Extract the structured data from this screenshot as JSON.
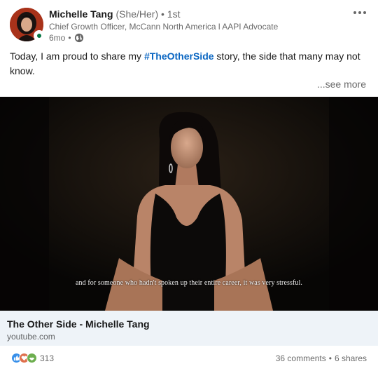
{
  "author": {
    "name": "Michelle Tang",
    "pronouns": "(She/Her)",
    "degree": "• 1st",
    "headline": "Chief Growth Officer, McCann North America l AAPI Advocate",
    "time": "6mo",
    "time_sep": "•",
    "presence_color": "#057642"
  },
  "post": {
    "text_before": "Today, I am proud to share my ",
    "hashtag": "#TheOtherSide",
    "text_after": " story, the side that many may not know.",
    "see_more": "...see more"
  },
  "video": {
    "caption": "and for someone who hadn't spoken up their entire career, it was very stressful."
  },
  "link": {
    "title": "The Other Side - Michelle Tang",
    "domain": "youtube.com"
  },
  "social": {
    "reaction_count": "313",
    "comments": "36 comments",
    "separator": "•",
    "shares": "6 shares",
    "reaction_icons": [
      "like-icon",
      "love-icon",
      "support-icon"
    ]
  },
  "colors": {
    "link_blue": "#0a66c2",
    "card_bg": "#eef3f8",
    "like": "#378fe9",
    "love": "#df704d",
    "support": "#6dae4f"
  }
}
